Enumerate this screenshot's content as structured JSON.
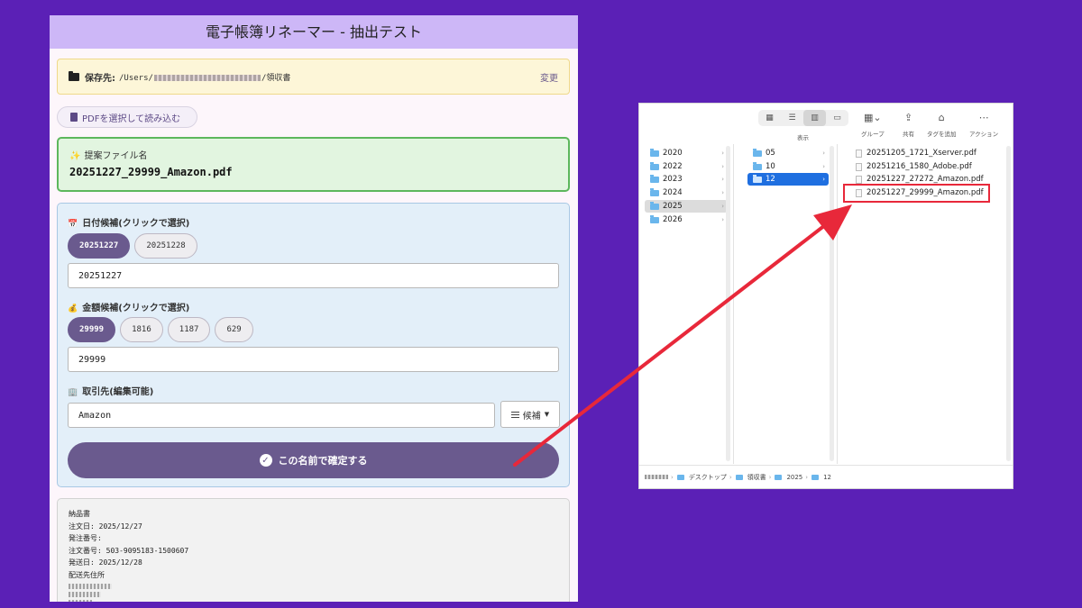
{
  "app": {
    "title": "電子帳簿リネーマー - 抽出テスト",
    "save": {
      "label": "保存先:",
      "path_prefix": "/Users/",
      "path_suffix": "/領収書",
      "change_label": "変更"
    },
    "pdf_button_label": "PDFを選択して読み込む",
    "suggestion": {
      "icon": "✨",
      "caption": "提案ファイル名",
      "filename": "20251227_29999_Amazon.pdf"
    },
    "date_section": {
      "icon": "📅",
      "heading": "日付候補(クリックで選択)",
      "pills": [
        "20251227",
        "20251228"
      ],
      "selected_index": 0,
      "value": "20251227"
    },
    "amount_section": {
      "icon": "💰",
      "heading": "金額候補(クリックで選択)",
      "pills": [
        "29999",
        "1816",
        "1187",
        "629"
      ],
      "selected_index": 0,
      "value": "29999"
    },
    "vendor_section": {
      "icon": "🏢",
      "heading": "取引先(編集可能)",
      "value": "Amazon",
      "candidates_label": "候補"
    },
    "confirm_label": "この名前で確定する",
    "extracted_text": [
      "納品書",
      "注文日: 2025/12/27",
      "発注番号:",
      "注文番号: 503-9095183-1500607",
      "発送日: 2025/12/28",
      "配送先住所"
    ]
  },
  "finder": {
    "toolbar": {
      "view_label": "表示",
      "group_label": "グループ",
      "share_label": "共有",
      "tag_label": "タグを追加",
      "action_label": "アクション"
    },
    "years": [
      "2020",
      "2022",
      "2023",
      "2024",
      "2025",
      "2026"
    ],
    "selected_year": "2025",
    "months": [
      "05",
      "10",
      "12"
    ],
    "selected_month": "12",
    "files": [
      "20251205_1721_Xserver.pdf",
      "20251216_1580_Adobe.pdf",
      "20251227_27272_Amazon.pdf",
      "20251227_29999_Amazon.pdf"
    ],
    "highlighted_file": "20251227_29999_Amazon.pdf",
    "path": [
      "デスクトップ",
      "領収書",
      "2025",
      "12"
    ]
  },
  "colors": {
    "background": "#5b20b6",
    "accent": "#6a5a8e",
    "title_bar": "#cdb7f7",
    "arrow": "#e8283a",
    "finder_selection": "#1f6fe0"
  }
}
